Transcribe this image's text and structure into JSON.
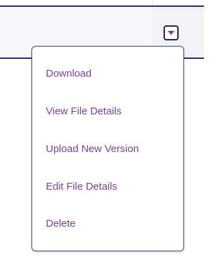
{
  "row_actions": {
    "trigger_icon": "caret-down-icon",
    "colors": {
      "accent": "#7b3fa6",
      "border": "#3b1f66"
    },
    "menu_items": [
      {
        "label": "Download"
      },
      {
        "label": "View File Details"
      },
      {
        "label": "Upload New Version"
      },
      {
        "label": "Edit File Details"
      },
      {
        "label": "Delete"
      }
    ]
  }
}
